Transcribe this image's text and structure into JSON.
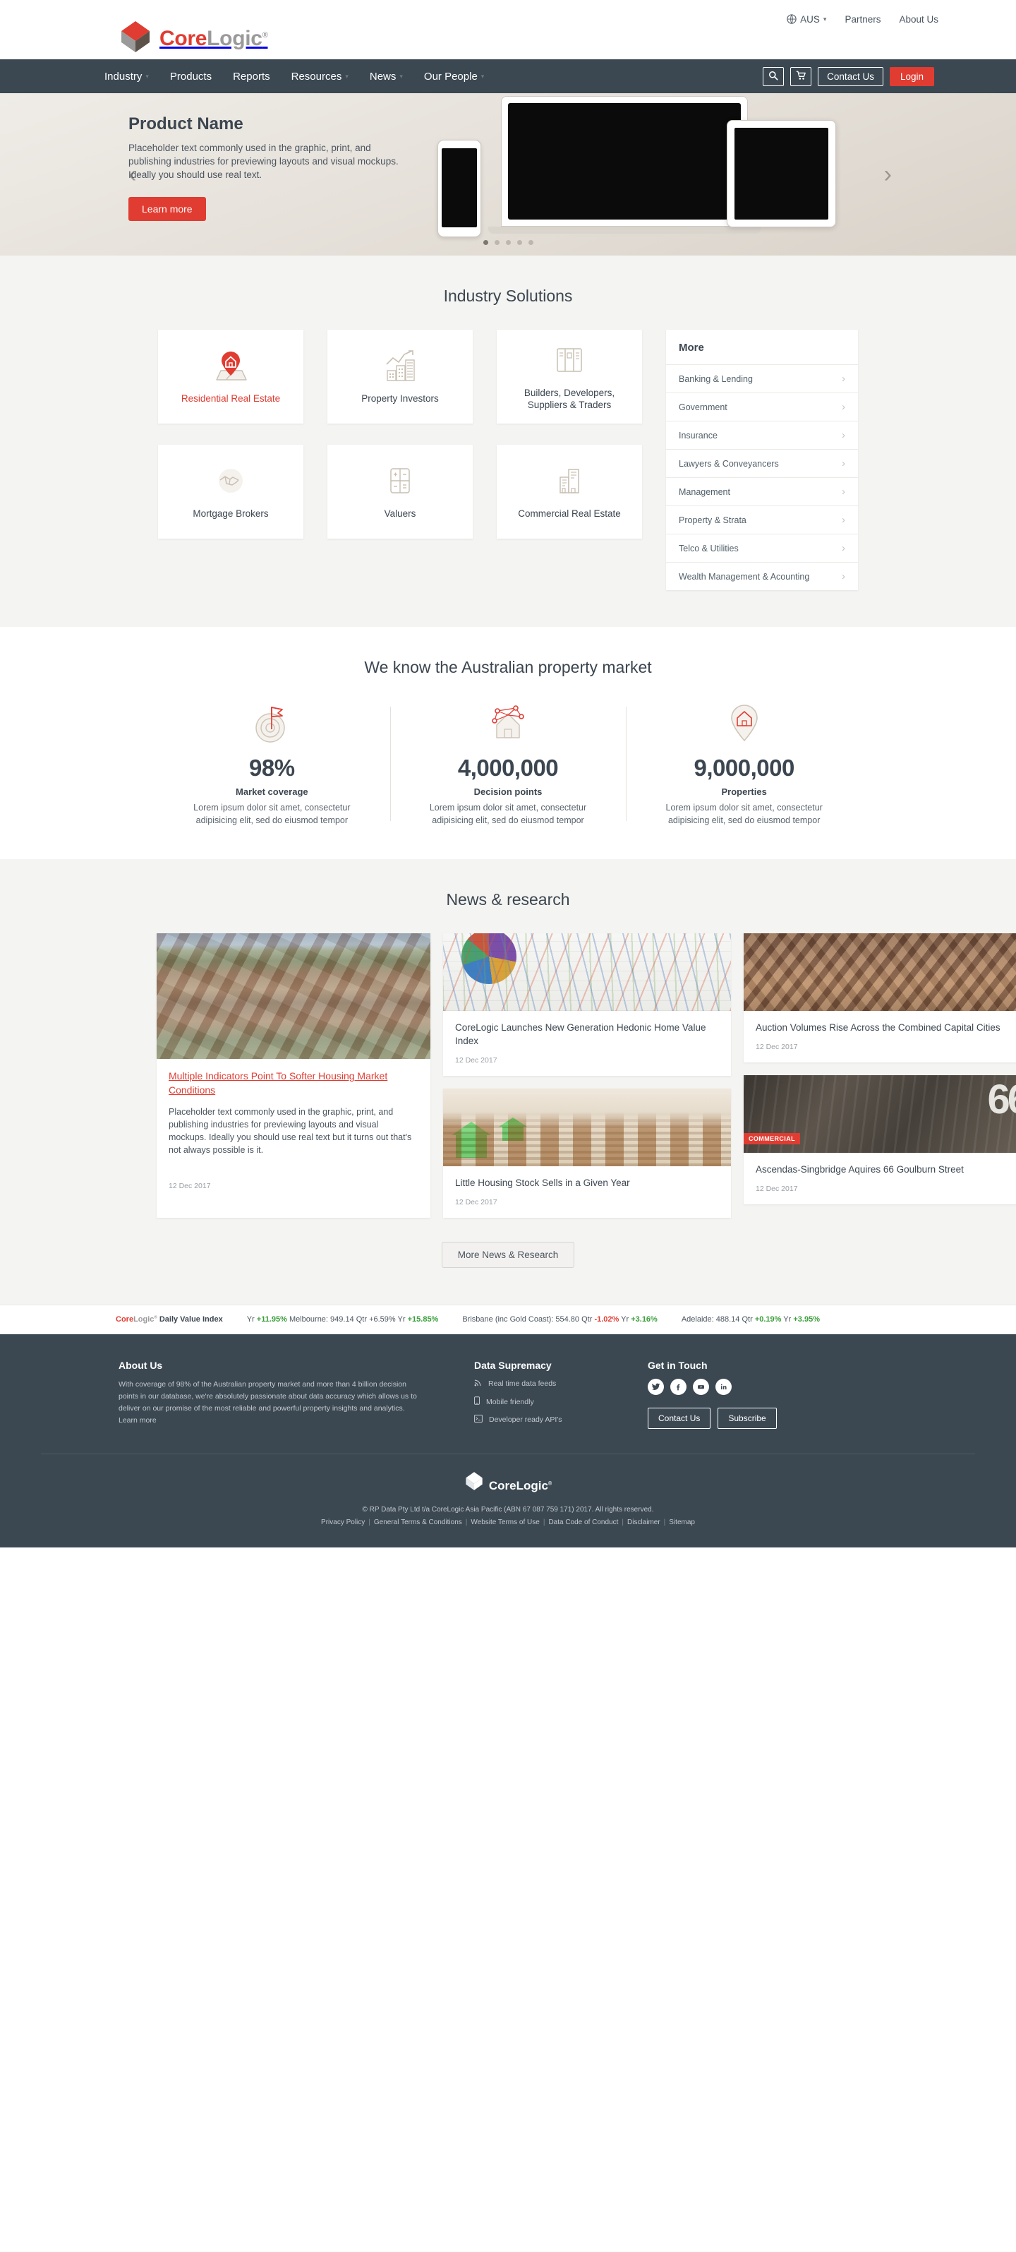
{
  "utility": {
    "region": "AUS",
    "links": [
      "Partners",
      "About Us"
    ]
  },
  "brand": {
    "name_part1": "Core",
    "name_part2": "Logic",
    "trademark": "®",
    "accent_color": "#e03c31",
    "grey_color": "#9a9a9a"
  },
  "nav": {
    "items": [
      {
        "label": "Industry",
        "has_caret": true
      },
      {
        "label": "Products",
        "has_caret": false
      },
      {
        "label": "Reports",
        "has_caret": false
      },
      {
        "label": "Resources",
        "has_caret": true
      },
      {
        "label": "News",
        "has_caret": true
      },
      {
        "label": "Our People",
        "has_caret": true
      }
    ],
    "search_icon": "search-icon",
    "cart_icon": "cart-icon",
    "contact_label": "Contact Us",
    "login_label": "Login"
  },
  "hero": {
    "title": "Product Name",
    "description": "Placeholder text commonly used in the graphic, print, and publishing industries for previewing layouts and visual mockups. Ideally you should use real text.",
    "cta": "Learn more",
    "slide_count": 5,
    "active_slide": 1,
    "prev_icon": "chevron-left-icon",
    "next_icon": "chevron-right-icon"
  },
  "industry": {
    "title": "Industry Solutions",
    "cards": [
      {
        "label": "Residential Real Estate",
        "icon": "map-pin-house-icon",
        "active": true
      },
      {
        "label": "Property Investors",
        "icon": "growth-chart-buildings-icon",
        "active": false
      },
      {
        "label": "Builders, Developers, Suppliers & Traders",
        "icon": "blueprint-icon",
        "active": false
      },
      {
        "label": "Mortgage Brokers",
        "icon": "handshake-icon",
        "active": false
      },
      {
        "label": "Valuers",
        "icon": "calculator-icon",
        "active": false
      },
      {
        "label": "Commercial Real Estate",
        "icon": "office-buildings-icon",
        "active": false
      }
    ],
    "more_title": "More",
    "more_items": [
      "Banking & Lending",
      "Government",
      "Insurance",
      "Lawyers & Conveyancers",
      "Management",
      "Property & Strata",
      "Telco & Utilities",
      "Wealth Management & Acounting"
    ]
  },
  "market": {
    "title": "We know the Australian property market",
    "stats": [
      {
        "value": "98%",
        "label": "Market coverage",
        "desc": "Lorem ipsum dolor sit amet, consectetur adipisicing elit, sed do eiusmod tempor",
        "icon": "target-flag-icon"
      },
      {
        "value": "4,000,000",
        "label": "Decision points",
        "desc": "Lorem ipsum dolor sit amet, consectetur adipisicing elit, sed do eiusmod tempor",
        "icon": "network-nodes-house-icon"
      },
      {
        "value": "9,000,000",
        "label": "Properties",
        "desc": "Lorem ipsum dolor sit amet, consectetur adipisicing elit, sed do eiusmod tempor",
        "icon": "house-pin-icon"
      }
    ]
  },
  "news": {
    "title": "News & research",
    "feature": {
      "title": "Multiple Indicators Point To Softer Housing Market Conditions",
      "desc": "Placeholder text commonly used in the graphic, print, and publishing industries for previewing layouts and visual mockups. Ideally you should use real text but it turns out that's not always possible is it.",
      "date": "12 Dec 2017",
      "image": "aerial-suburb-photo"
    },
    "cards": [
      {
        "title": "CoreLogic Launches New Generation Hedonic Home Value Index",
        "date": "12 Dec 2017",
        "image": "charts-graphs-photo",
        "badge": ""
      },
      {
        "title": "Auction Volumes Rise Across the Combined Capital Cities",
        "date": "12 Dec 2017",
        "image": "tiled-roofs-photo",
        "badge": ""
      },
      {
        "title": "Little Housing Stock Sells in a Given Year",
        "date": "12 Dec 2017",
        "image": "green-houses-coins-photo",
        "badge": ""
      },
      {
        "title": "Ascendas-Singbridge Aquires 66 Goulburn Street",
        "date": "12 Dec 2017",
        "image": "building-lobby-66-photo",
        "badge": "COMMERCIAL"
      }
    ],
    "more_button": "More News & Research"
  },
  "ticker": {
    "brand_label": "Daily Value Index",
    "segments": [
      {
        "text": "Yr ",
        "type": "plain"
      },
      {
        "text": "+11.95%",
        "type": "up"
      },
      {
        "text": " Melbourne: 949.14 Qtr +6.59% Yr ",
        "type": "plain"
      },
      {
        "text": "+15.85%",
        "type": "up"
      }
    ],
    "items": [
      {
        "prefix": "Brisbane (inc Gold Coast): 554.80 Qtr ",
        "qtr": "-1.02%",
        "qtr_dir": "down",
        "mid": " Yr ",
        "yr": "+3.16%",
        "yr_dir": "up"
      },
      {
        "prefix": "Adelaide: 488.14 Qtr ",
        "qtr": "+0.19%",
        "qtr_dir": "up",
        "mid": " Yr ",
        "yr": "+3.95%",
        "yr_dir": "up"
      }
    ]
  },
  "footer": {
    "about_title": "About Us",
    "about_text": "With coverage of 98% of the Australian property market and more than 4 billion decision points in our database, we're absolutely passionate about data accuracy which allows us to deliver on our promise of the most reliable and powerful property insights and analytics. Learn more",
    "data_title": "Data Supremacy",
    "data_items": [
      {
        "label": "Real time data feeds",
        "icon": "rss-feed-icon"
      },
      {
        "label": "Mobile friendly",
        "icon": "mobile-phone-icon"
      },
      {
        "label": "Developer ready API's",
        "icon": "terminal-code-icon"
      }
    ],
    "touch_title": "Get in Touch",
    "socials": [
      "twitter-icon",
      "facebook-icon",
      "youtube-icon",
      "linkedin-icon"
    ],
    "contact_label": "Contact Us",
    "subscribe_label": "Subscribe",
    "copyright": "© RP Data Pty Ltd t/a CoreLogic Asia Pacific (ABN 67 087 759 171) 2017. All rights reserved.",
    "legal_links": [
      "Privacy Policy",
      "General Terms & Conditions",
      "Website Terms of Use",
      "Data Code of Conduct",
      "Disclaimer",
      "Sitemap"
    ]
  }
}
